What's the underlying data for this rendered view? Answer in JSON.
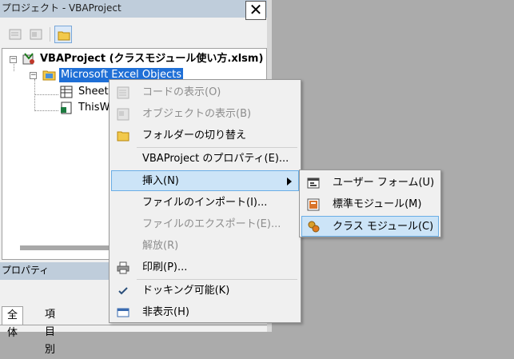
{
  "pane": {
    "title": "プロジェクト - VBAProject",
    "close_glyph": "✕"
  },
  "tree": {
    "root_label": "VBAProject (クラスモジュール使い方.xlsm)",
    "objects_label": "Microsoft Excel Objects",
    "sheet_label": "Sheet",
    "thisworkbook_label": "ThisW"
  },
  "properties": {
    "header": "プロパティ",
    "tab_all": "全体",
    "tab_category": "項目別"
  },
  "context_menu": {
    "items": [
      {
        "label": "コードの表示(O)",
        "icon": "code-icon",
        "enabled": false
      },
      {
        "label": "オブジェクトの表示(B)",
        "icon": "object-icon",
        "enabled": false
      },
      {
        "label": "フォルダーの切り替え",
        "icon": "folder-icon",
        "enabled": true
      },
      {
        "label": "VBAProject のプロパティ(E)...",
        "icon": "",
        "enabled": true
      },
      {
        "label": "挿入(N)",
        "icon": "",
        "enabled": true,
        "highlighted": true,
        "has_submenu": true
      },
      {
        "label": "ファイルのインポート(I)...",
        "icon": "",
        "enabled": true
      },
      {
        "label": "ファイルのエクスポート(E)...",
        "icon": "",
        "enabled": false
      },
      {
        "label": "解放(R)",
        "icon": "",
        "enabled": false
      },
      {
        "label": "印刷(P)...",
        "icon": "printer-icon",
        "enabled": true
      },
      {
        "label": "ドッキング可能(K)",
        "icon": "checkmark-icon",
        "enabled": true,
        "checked": true
      },
      {
        "label": "非表示(H)",
        "icon": "window-icon",
        "enabled": true
      }
    ]
  },
  "submenu": {
    "items": [
      {
        "label": "ユーザー フォーム(U)",
        "icon": "userform-icon"
      },
      {
        "label": "標準モジュール(M)",
        "icon": "module-icon"
      },
      {
        "label": "クラス モジュール(C)",
        "icon": "class-module-icon",
        "highlighted": true
      }
    ]
  },
  "colors": {
    "title_bar": "#bfcddb",
    "selection": "#1f6fd6",
    "menu_highlight": "#cce4f7",
    "menu_highlight_border": "#6aaee6",
    "desktop": "#ababab"
  }
}
